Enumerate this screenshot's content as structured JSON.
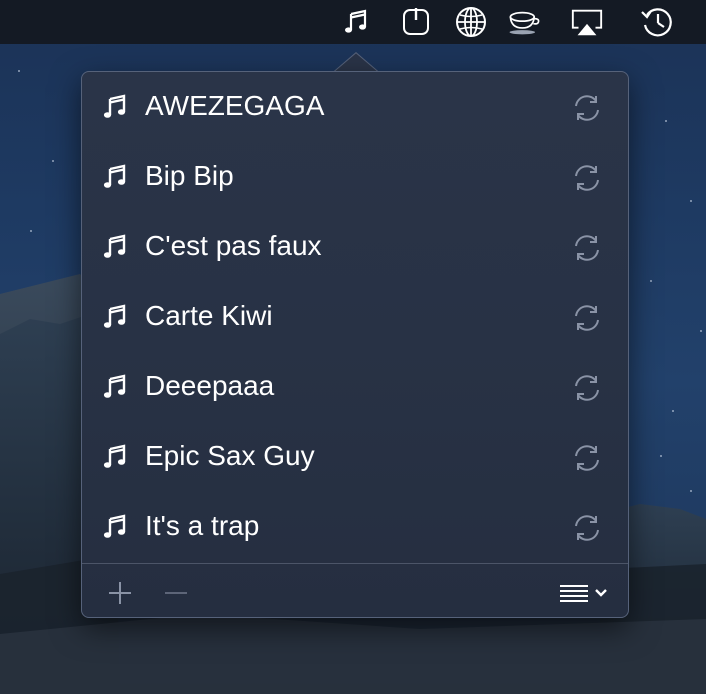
{
  "menubar": {
    "icons": [
      "music-note-icon",
      "power-icon",
      "globe-icon",
      "coffee-cup-icon",
      "airplay-icon",
      "time-machine-icon"
    ]
  },
  "colors": {
    "popover_bg": "#283245",
    "text": "#ffffff",
    "icon_muted": "#8a93a6"
  },
  "sounds": {
    "items": [
      {
        "label": "AWEZEGAGA",
        "icon": "music-note-icon",
        "loop_icon": "loop-icon"
      },
      {
        "label": "Bip Bip",
        "icon": "music-note-icon",
        "loop_icon": "loop-icon"
      },
      {
        "label": "C'est pas faux",
        "icon": "music-note-icon",
        "loop_icon": "loop-icon"
      },
      {
        "label": "Carte Kiwi",
        "icon": "music-note-icon",
        "loop_icon": "loop-icon"
      },
      {
        "label": "Deeepaaa",
        "icon": "music-note-icon",
        "loop_icon": "loop-icon"
      },
      {
        "label": "Epic Sax Guy",
        "icon": "music-note-icon",
        "loop_icon": "loop-icon"
      },
      {
        "label": "It's a trap",
        "icon": "music-note-icon",
        "loop_icon": "loop-icon"
      }
    ]
  },
  "footer": {
    "add_icon": "plus-icon",
    "remove_icon": "minus-icon",
    "menu_icon": "list-menu-icon"
  }
}
